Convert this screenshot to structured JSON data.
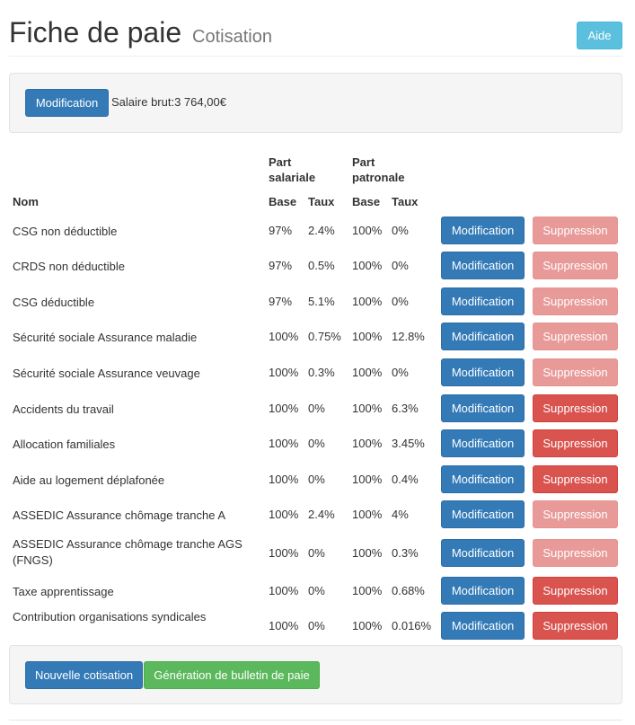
{
  "header": {
    "title": "Fiche de paie",
    "subtitle": "Cotisation",
    "help_label": "Aide"
  },
  "top_panel": {
    "modify_label": "Modification",
    "salary_text": "Salaire brut:3 764,00€"
  },
  "table": {
    "headers": {
      "name": "Nom",
      "part_salariale": "Part\nsalariale",
      "part_patronale": "Part\npatronale",
      "base": "Base",
      "taux": "Taux"
    },
    "rows": [
      {
        "name": "CSG non déductible",
        "sal_base": "97%",
        "sal_taux": "2.4%",
        "pat_base": "100%",
        "pat_taux": "0%",
        "modify": "Modification",
        "delete": "Suppression",
        "delete_enabled": false
      },
      {
        "name": "CRDS non déductible",
        "sal_base": "97%",
        "sal_taux": "0.5%",
        "pat_base": "100%",
        "pat_taux": "0%",
        "modify": "Modification",
        "delete": "Suppression",
        "delete_enabled": false
      },
      {
        "name": "CSG déductible",
        "sal_base": "97%",
        "sal_taux": "5.1%",
        "pat_base": "100%",
        "pat_taux": "0%",
        "modify": "Modification",
        "delete": "Suppression",
        "delete_enabled": false
      },
      {
        "name": "Sécurité sociale Assurance maladie",
        "sal_base": "100%",
        "sal_taux": "0.75%",
        "pat_base": "100%",
        "pat_taux": "12.8%",
        "modify": "Modification",
        "delete": "Suppression",
        "delete_enabled": false
      },
      {
        "name": "Sécurité sociale Assurance veuvage",
        "sal_base": "100%",
        "sal_taux": "0.3%",
        "pat_base": "100%",
        "pat_taux": "0%",
        "modify": "Modification",
        "delete": "Suppression",
        "delete_enabled": false
      },
      {
        "name": "Accidents du travail",
        "sal_base": "100%",
        "sal_taux": "0%",
        "pat_base": "100%",
        "pat_taux": "6.3%",
        "modify": "Modification",
        "delete": "Suppression",
        "delete_enabled": true
      },
      {
        "name": "Allocation familiales",
        "sal_base": "100%",
        "sal_taux": "0%",
        "pat_base": "100%",
        "pat_taux": "3.45%",
        "modify": "Modification",
        "delete": "Suppression",
        "delete_enabled": true
      },
      {
        "name": "Aide au logement déplafonée",
        "sal_base": "100%",
        "sal_taux": "0%",
        "pat_base": "100%",
        "pat_taux": "0.4%",
        "modify": "Modification",
        "delete": "Suppression",
        "delete_enabled": true
      },
      {
        "name": "ASSEDIC Assurance chômage tranche A",
        "sal_base": "100%",
        "sal_taux": "2.4%",
        "pat_base": "100%",
        "pat_taux": "4%",
        "modify": "Modification",
        "delete": "Suppression",
        "delete_enabled": false
      },
      {
        "name": "ASSEDIC Assurance chômage tranche AGS (FNGS)",
        "sal_base": "100%",
        "sal_taux": "0%",
        "pat_base": "100%",
        "pat_taux": "0.3%",
        "modify": "Modification",
        "delete": "Suppression",
        "delete_enabled": false
      },
      {
        "name": "Taxe apprentissage",
        "sal_base": "100%",
        "sal_taux": "0%",
        "pat_base": "100%",
        "pat_taux": "0.68%",
        "modify": "Modification",
        "delete": "Suppression",
        "delete_enabled": true
      },
      {
        "name": "Contribution organisations syndicales",
        "sal_base": "100%",
        "sal_taux": "0%",
        "pat_base": "100%",
        "pat_taux": "0.016%",
        "modify": "Modification",
        "delete": "Suppression",
        "delete_enabled": true
      }
    ]
  },
  "bottom_panel": {
    "new_label": "Nouvelle cotisation",
    "generate_label": "Génération de bulletin de paie"
  },
  "colors": {
    "primary": "#337ab7",
    "info": "#5bc0de",
    "danger": "#d9534f",
    "danger_disabled": "#e89a98",
    "success": "#5cb85c",
    "well_bg": "#f5f5f5"
  }
}
